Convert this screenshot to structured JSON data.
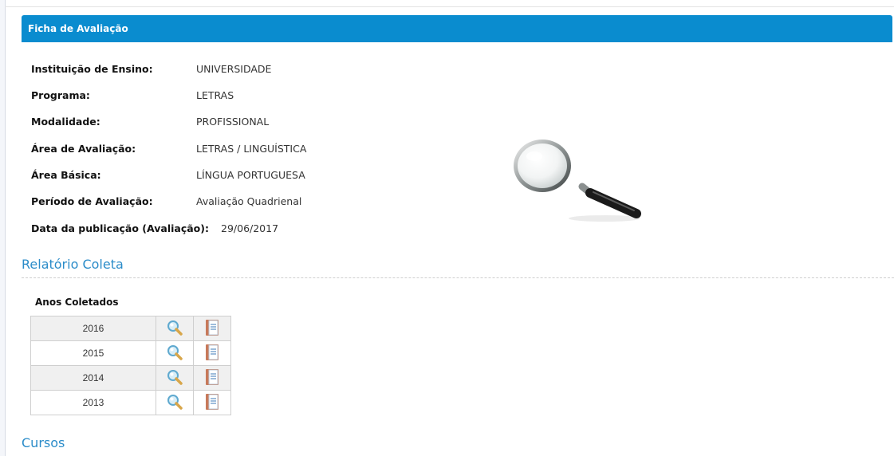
{
  "header": {
    "title": "Ficha de Avaliação"
  },
  "info": [
    {
      "label": "Instituição de Ensino:",
      "value": "UNIVERSIDADE"
    },
    {
      "label": "Programa:",
      "value": "LETRAS"
    },
    {
      "label": "Modalidade:",
      "value": "PROFISSIONAL"
    },
    {
      "label": "Área de Avaliação:",
      "value": "LETRAS / LINGUÍSTICA"
    },
    {
      "label": "Área Básica:",
      "value": "LÍNGUA PORTUGUESA"
    },
    {
      "label": "Período de Avaliação:",
      "value": "Avaliação Quadrienal"
    },
    {
      "label": "Data da publicação (Avaliação):",
      "value": "29/06/2017"
    }
  ],
  "relatorio": {
    "title": "Relatório Coleta",
    "table_caption": "Anos Coletados",
    "years": [
      "2016",
      "2015",
      "2014",
      "2013"
    ]
  },
  "cursos": {
    "title": "Cursos"
  },
  "icons": {
    "decorative": "magnifying-glass-icon",
    "view": "search-icon",
    "report": "document-icon"
  }
}
